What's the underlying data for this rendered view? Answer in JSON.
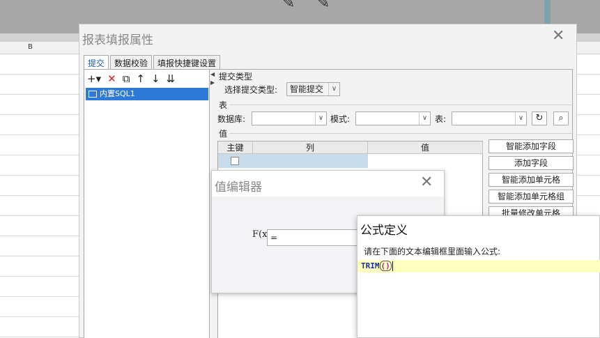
{
  "background": {
    "column_b": "B"
  },
  "main_dialog": {
    "title": "报表填报属性",
    "tabs": [
      "提交",
      "数据校验",
      "填报快捷键设置"
    ],
    "tree_item": "内置SQL1",
    "submit_type_section": "提交类型",
    "submit_type_label": "选择提交类型:",
    "submit_type_value": "智能提交",
    "table_section": "表",
    "database_label": "数据库:",
    "database_value": "",
    "schema_label": "模式:",
    "schema_value": "",
    "table_label": "表:",
    "table_value": "",
    "value_section": "值",
    "columns": [
      "主键",
      "列",
      "值"
    ],
    "buttons": [
      "智能添加字段",
      "添加字段",
      "智能添加单元格",
      "智能添加单元格组",
      "批量修改单元格"
    ]
  },
  "value_editor": {
    "title": "值编辑器",
    "fx_label": "F(x)",
    "input_value": "="
  },
  "formula_dialog": {
    "title": "公式定义",
    "prompt": "请在下面的文本编辑框里面输入公式:",
    "code_fn": "TRIM",
    "code_parens": "()"
  }
}
